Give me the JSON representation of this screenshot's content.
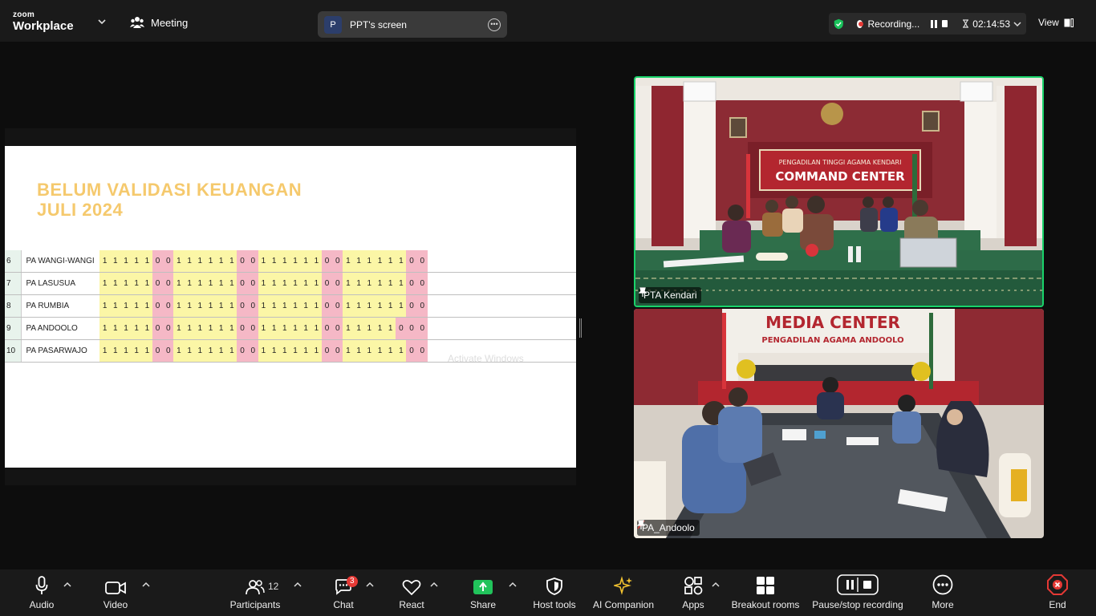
{
  "app": {
    "brand_top": "zoom",
    "brand_bottom": "Workplace"
  },
  "meeting": {
    "label": "Meeting"
  },
  "screen_share": {
    "avatar_letter": "P",
    "label": "PPT's screen"
  },
  "recording": {
    "label": "Recording...",
    "timer": "02:14:53"
  },
  "view": {
    "label": "View"
  },
  "slide": {
    "title_line1": "BELUM VALIDASI KEUANGAN",
    "title_line2": "JULI 2024",
    "watermark": "Activate Windows",
    "rows": [
      {
        "no": "6",
        "name": "PA WANGI-WANGI",
        "cells": [
          "1",
          "1",
          "1",
          "1",
          "1",
          "0",
          "0",
          "1",
          "1",
          "1",
          "1",
          "1",
          "1",
          "0",
          "0",
          "1",
          "1",
          "1",
          "1",
          "1",
          "1",
          "0",
          "0",
          "1",
          "1",
          "1",
          "1",
          "1",
          "1",
          "0",
          "0"
        ]
      },
      {
        "no": "7",
        "name": "PA LASUSUA",
        "cells": [
          "1",
          "1",
          "1",
          "1",
          "1",
          "0",
          "0",
          "1",
          "1",
          "1",
          "1",
          "1",
          "1",
          "0",
          "0",
          "1",
          "1",
          "1",
          "1",
          "1",
          "1",
          "0",
          "0",
          "1",
          "1",
          "1",
          "1",
          "1",
          "1",
          "0",
          "0"
        ]
      },
      {
        "no": "8",
        "name": "PA RUMBIA",
        "cells": [
          "1",
          "1",
          "1",
          "1",
          "1",
          "0",
          "0",
          "1",
          "1",
          "1",
          "1",
          "1",
          "1",
          "0",
          "0",
          "1",
          "1",
          "1",
          "1",
          "1",
          "1",
          "0",
          "0",
          "1",
          "1",
          "1",
          "1",
          "1",
          "1",
          "0",
          "0"
        ]
      },
      {
        "no": "9",
        "name": "PA ANDOOLO",
        "cells": [
          "1",
          "1",
          "1",
          "1",
          "1",
          "0",
          "0",
          "1",
          "1",
          "1",
          "1",
          "1",
          "1",
          "0",
          "0",
          "1",
          "1",
          "1",
          "1",
          "1",
          "1",
          "0",
          "0",
          "1",
          "1",
          "1",
          "1",
          "1",
          "0",
          "0",
          "0"
        ]
      },
      {
        "no": "10",
        "name": "PA PASARWAJO",
        "cells": [
          "1",
          "1",
          "1",
          "1",
          "1",
          "0",
          "0",
          "1",
          "1",
          "1",
          "1",
          "1",
          "1",
          "0",
          "0",
          "1",
          "1",
          "1",
          "1",
          "1",
          "1",
          "0",
          "0",
          "1",
          "1",
          "1",
          "1",
          "1",
          "1",
          "0",
          "0"
        ]
      }
    ]
  },
  "participants": {
    "tile1": {
      "name": "PTA Kendari",
      "sign_line1": "PENGADILAN TINGGI AGAMA KENDARI",
      "sign_line2": "COMMAND CENTER"
    },
    "tile2": {
      "name": "PA_Andoolo",
      "sign_line1": "MEDIA CENTER",
      "sign_line2": "PENGADILAN AGAMA ANDOOLO"
    }
  },
  "toolbar": {
    "audio": "Audio",
    "video": "Video",
    "participants": "Participants",
    "participants_count": "12",
    "chat": "Chat",
    "chat_badge": "3",
    "react": "React",
    "share": "Share",
    "host_tools": "Host tools",
    "ai_companion": "AI Companion",
    "apps": "Apps",
    "breakout": "Breakout rooms",
    "pause_stop": "Pause/stop recording",
    "more": "More",
    "end": "End"
  },
  "colors": {
    "accent_green": "#19d36a",
    "share_green": "#21c35b",
    "end_red": "#e53935",
    "title_yellow": "#f5c96d",
    "ai_yellow": "#f2c230"
  }
}
